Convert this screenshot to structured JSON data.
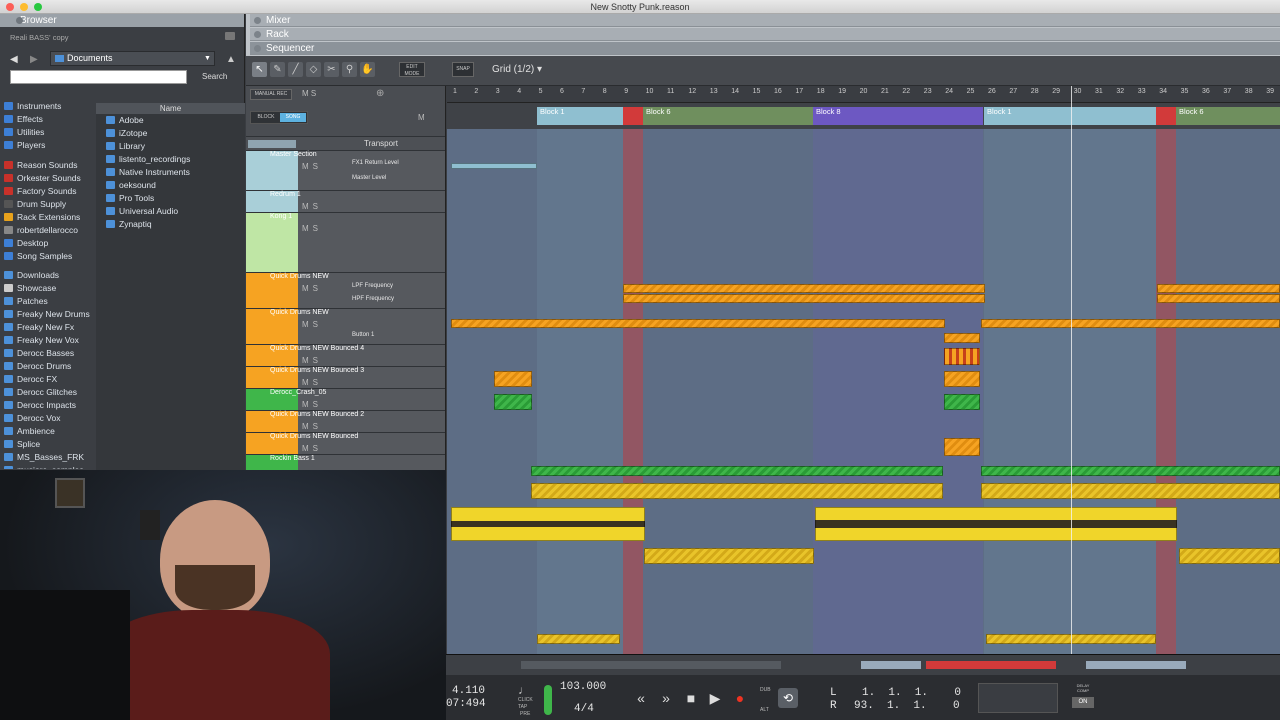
{
  "window": {
    "title": "New Snotty Punk.reason"
  },
  "browser": {
    "header": "Browser",
    "device_label": "Reali BASS' copy",
    "location": "Documents",
    "search_button": "Search",
    "name_column": "Name",
    "places": [
      "Instruments",
      "Effects",
      "Utilities",
      "Players"
    ],
    "sources": [
      "Reason Sounds",
      "Orkester Sounds",
      "Factory Sounds",
      "Drum Supply",
      "Rack Extensions",
      "robertdellarocco",
      "Desktop",
      "Song Samples"
    ],
    "locations": [
      "Downloads",
      "Showcase",
      "Patches",
      "Freaky New Drums",
      "Freaky New Fx",
      "Freaky New Vox",
      "Derocc Basses",
      "Derocc Drums",
      "Derocc FX",
      "Derocc Glitches",
      "Derocc Impacts",
      "Derocc Vox",
      "Ambience",
      "Splice",
      "MS_Basses_FRK",
      "musiore_samples"
    ],
    "folders": [
      "Adobe",
      "iZotope",
      "Library",
      "listento_recordings",
      "Native Instruments",
      "oeksound",
      "Pro Tools",
      "Universal Audio",
      "Zynaptiq"
    ]
  },
  "tabs": {
    "mixer": "Mixer",
    "rack": "Rack",
    "sequencer": "Sequencer"
  },
  "toolbar": {
    "edit_mode": "EDIT MODE",
    "snap": "SNAP",
    "grid": "Grid (1/2)",
    "manual_rec": "MANUAL REC",
    "block": "BLOCK",
    "song": "SONG",
    "transport": "Transport"
  },
  "tracks": [
    {
      "name": "Master Section",
      "lanes": [
        "FX1 Return Level",
        "Master Level"
      ]
    },
    {
      "name": "Redrum 1"
    },
    {
      "name": "Kong 1"
    },
    {
      "name": "Quick Drums NEW",
      "lanes": [
        "LPF Frequency",
        "HPF Frequency"
      ]
    },
    {
      "name": "Quick Drums NEW",
      "lanes": [
        "Button 1"
      ]
    },
    {
      "name": "Quick Drums NEW Bounced 4"
    },
    {
      "name": "Quick Drums NEW Bounced 3"
    },
    {
      "name": "Derocc_Crash_05"
    },
    {
      "name": "Quick Drums NEW Bounced 2"
    },
    {
      "name": "Quick Drums NEW Bounced"
    },
    {
      "name": "Rockin Bass 1"
    }
  ],
  "ruler": [
    "1",
    "2",
    "3",
    "4",
    "5",
    "6",
    "7",
    "8",
    "9",
    "10",
    "11",
    "12",
    "13",
    "14",
    "15",
    "16",
    "17",
    "18",
    "19",
    "20",
    "21",
    "22",
    "23",
    "24",
    "25",
    "26",
    "27",
    "28",
    "29",
    "30",
    "31",
    "32",
    "33",
    "34",
    "35",
    "36",
    "37",
    "38",
    "39"
  ],
  "blocks": [
    {
      "label": "Block 1",
      "color": "#8fbfd0"
    },
    {
      "label": "Block 6",
      "color": "#6f8f5e"
    },
    {
      "label": "Block 8",
      "color": "#6d58c2"
    },
    {
      "label": "Block 1",
      "color": "#8fbfd0"
    },
    {
      "label": "Block 6",
      "color": "#6f8f5e"
    }
  ],
  "transport": {
    "position": "4.110",
    "time": "07:494",
    "tempo": "103.000",
    "signature": "4/4",
    "tap": "TAP",
    "click": "CLICK",
    "pre": "PRE",
    "dub": "DUB",
    "alt": "ALT",
    "L": "L",
    "R": "R",
    "left_loc": "1.  1.  1.    0",
    "right_loc": "93.  1.  1.    0",
    "delay_comp": "DELAY COMP",
    "on": "ON"
  },
  "colors": {
    "accent": "#f0d52a",
    "orange": "#f6a322",
    "green": "#3fb64a",
    "red": "#d23a3a"
  }
}
